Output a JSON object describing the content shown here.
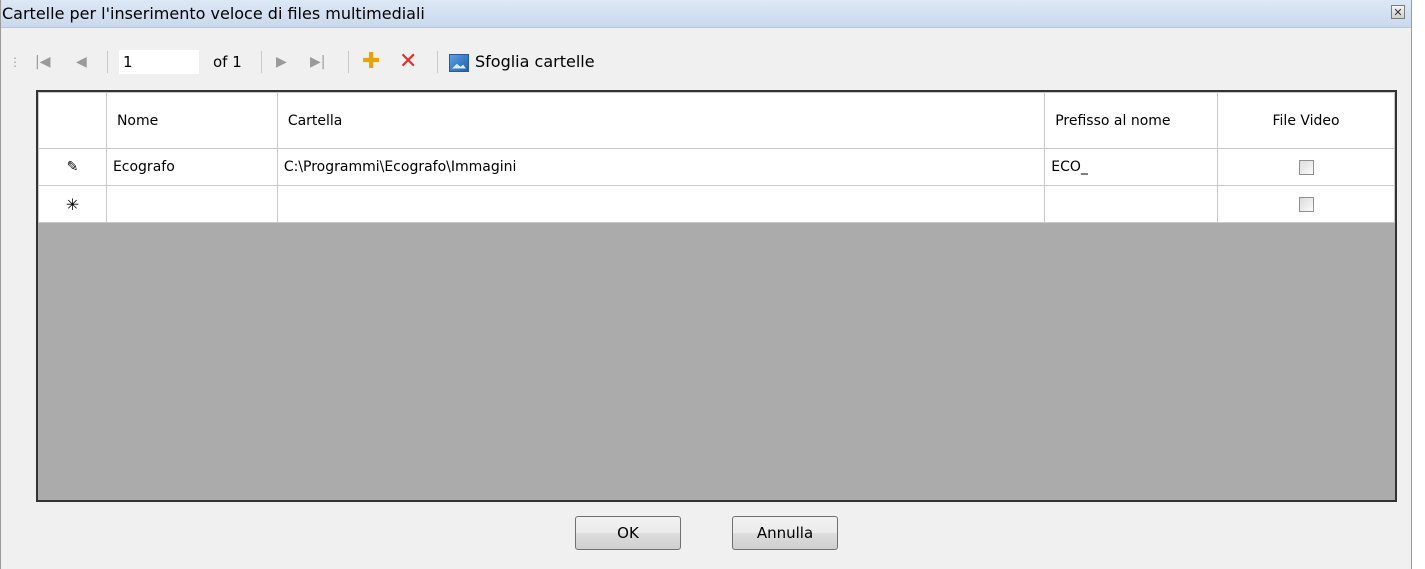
{
  "window": {
    "title": "Cartelle per l'inserimento veloce di files multimediali"
  },
  "toolbar": {
    "position_value": "1",
    "of_label": "of 1",
    "browse_label": "Sfoglia cartelle"
  },
  "grid": {
    "columns": [
      "Nome",
      "Cartella",
      "Prefisso al nome",
      "File Video"
    ],
    "rows": [
      {
        "indicator": "✎",
        "nome": "Ecografo",
        "cartella": "C:\\Programmi\\Ecografo\\Immagini",
        "prefisso": "ECO_",
        "file_video": false
      },
      {
        "indicator": "✳",
        "nome": "",
        "cartella": "",
        "prefisso": "",
        "file_video": false
      }
    ]
  },
  "buttons": {
    "ok": "OK",
    "cancel": "Annulla"
  }
}
